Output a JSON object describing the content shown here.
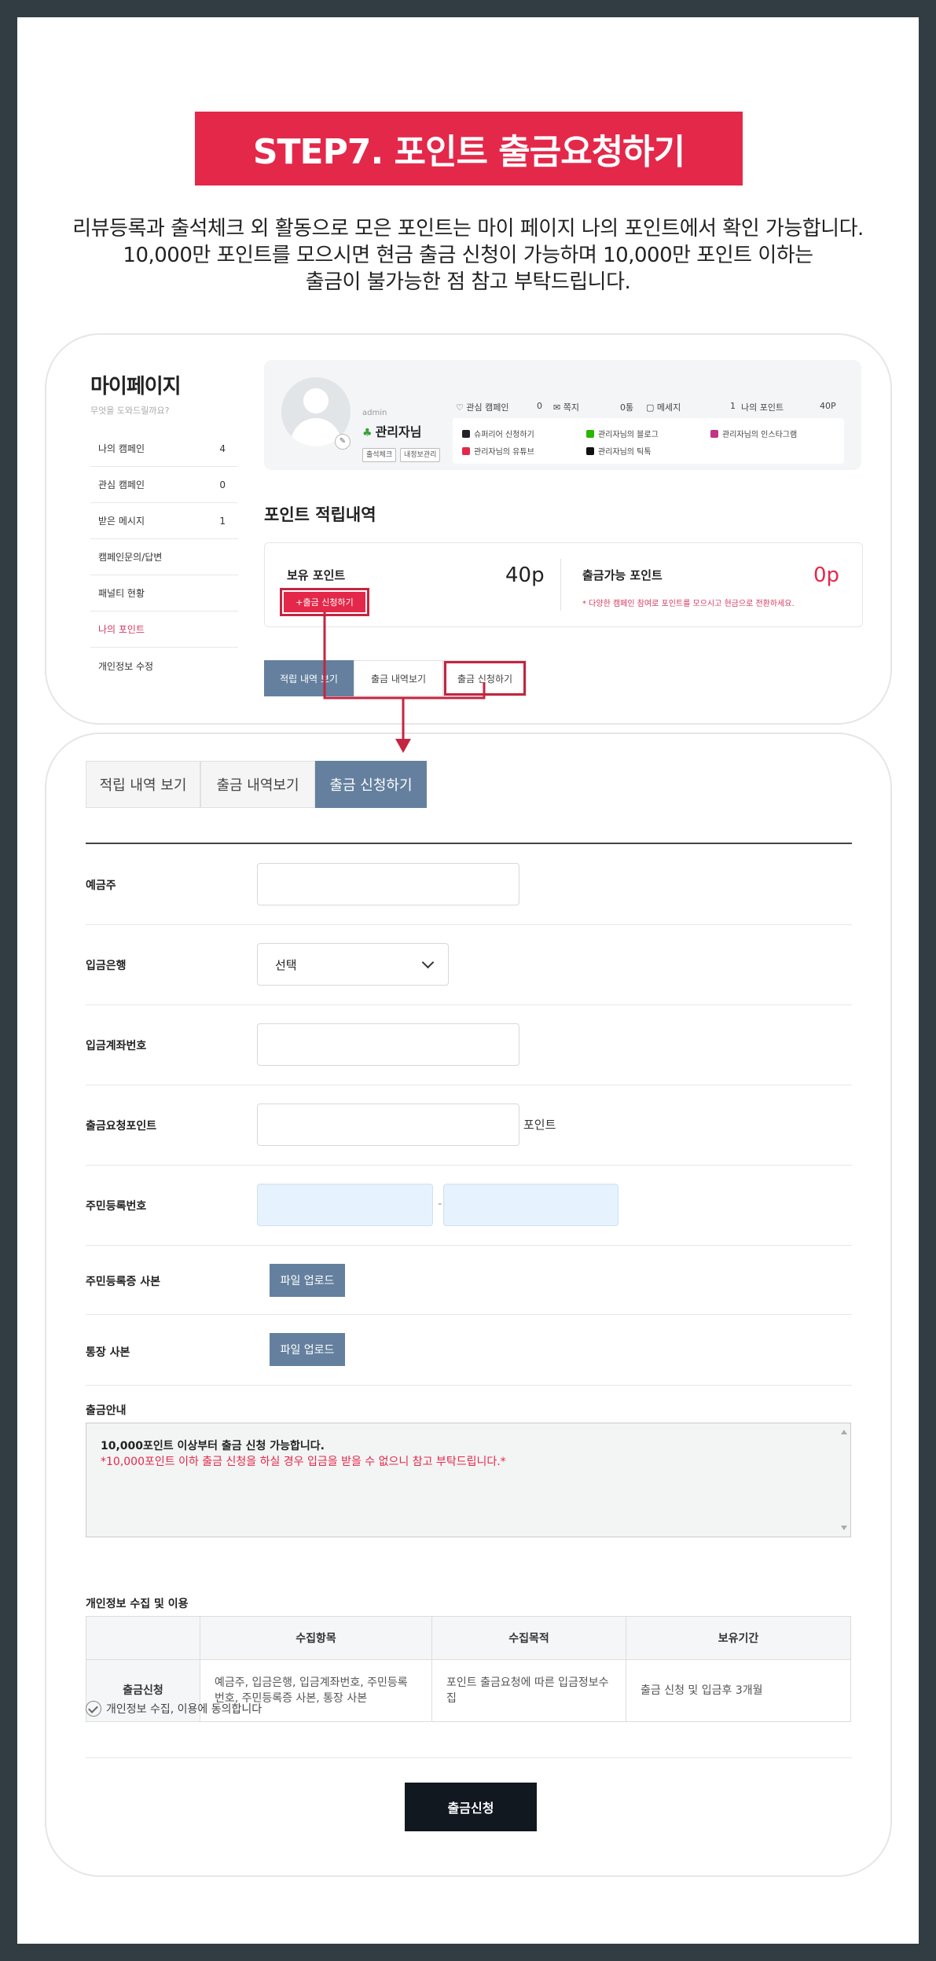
{
  "banner": "STEP7. 포인트 출금요청하기",
  "intro": [
    "리뷰등록과 출석체크 외 활동으로 모은 포인트는 마이 페이지 나의 포인트에서 확인 가능합니다.",
    "10,000만 포인트를 모으시면 현금 출금 신청이 가능하며 10,000만 포인트 이하는",
    "출금이 불가능한 점 참고 부탁드립니다."
  ],
  "mypage": {
    "title": "마이페이지",
    "subtitle": "무엇을 도와드릴까요?",
    "menu": [
      {
        "label": "나의 캠페인",
        "count": "4"
      },
      {
        "label": "관심 캠페인",
        "count": "0"
      },
      {
        "label": "받은 메시지",
        "count": "1"
      },
      {
        "label": "캠페인문의/답변",
        "count": ""
      },
      {
        "label": "패널티 현황",
        "count": ""
      },
      {
        "label": "나의 포인트",
        "count": ""
      },
      {
        "label": "개인정보 수정",
        "count": ""
      }
    ],
    "profile": {
      "role": "admin",
      "name": "관리자님",
      "badges": [
        "출석체크",
        "내정보관리"
      ],
      "stats": [
        {
          "label": "관심 캠페인",
          "value": "0"
        },
        {
          "label": "쪽지",
          "value": "0통"
        },
        {
          "label": "메세지",
          "value": "1"
        },
        {
          "label": "나의 포인트",
          "value": "40P"
        }
      ],
      "links": [
        {
          "label": "슈퍼리어 신청하기",
          "color": "#222222"
        },
        {
          "label": "관리자님의 블로그",
          "color": "#2db400"
        },
        {
          "label": "관리자님의 인스타그램",
          "color": "#c13584"
        },
        {
          "label": "관리자님의 유튜브",
          "color": "#e4284a"
        },
        {
          "label": "관리자님의 틱톡",
          "color": "#111111"
        }
      ]
    },
    "section_title": "포인트 적립내역",
    "held_label": "보유 포인트",
    "held_value": "40p",
    "withdraw_btn": "+출금 신청하기",
    "avail_label": "출금가능 포인트",
    "avail_value": "0p",
    "avail_note": "* 다양한 캠페인 참여로 포인트를 모으시고 현금으로 전환하세요.",
    "tabs": [
      "적립 내역 보기",
      "출금 내역보기",
      "출금 신청하기"
    ]
  },
  "form": {
    "tabs": [
      "적립 내역 보기",
      "출금 내역보기",
      "출금 신청하기"
    ],
    "labels": {
      "holder": "예금주",
      "bank": "입금은행",
      "account": "입금계좌번호",
      "points": "출금요청포인트",
      "rrn": "주민등록번호",
      "rrn_copy": "주민등록증 사본",
      "bankbook": "통장 사본"
    },
    "bank_selected": "선택",
    "points_unit": "포인트",
    "rrn_sep": "-",
    "upload_label": "파일 업로드",
    "notice_title": "출금안내",
    "notice_line1": "10,000포인트 이상부터 출금 신청 가능합니다.",
    "notice_line2": "*10,000포인트 이하 출금 신청을 하실 경우 입금을 받을 수 없으니 참고 부탁드립니다.*",
    "privacy_title": "개인정보 수집 및 이용",
    "privacy_headers": [
      "",
      "수집항목",
      "수집목적",
      "보유기간"
    ],
    "privacy_row": {
      "name": "출금신청",
      "items": "예금주, 입금은행, 입금계좌번호, 주민등록번호, 주민등록증 사본, 통장 사본",
      "purpose": "포인트 출금요청에 따른 입금정보수집",
      "period": "출금 신청 및 입금후 3개월"
    },
    "agree_label": "개인정보 수집, 이용에 동의합니다",
    "submit": "출금신청"
  }
}
